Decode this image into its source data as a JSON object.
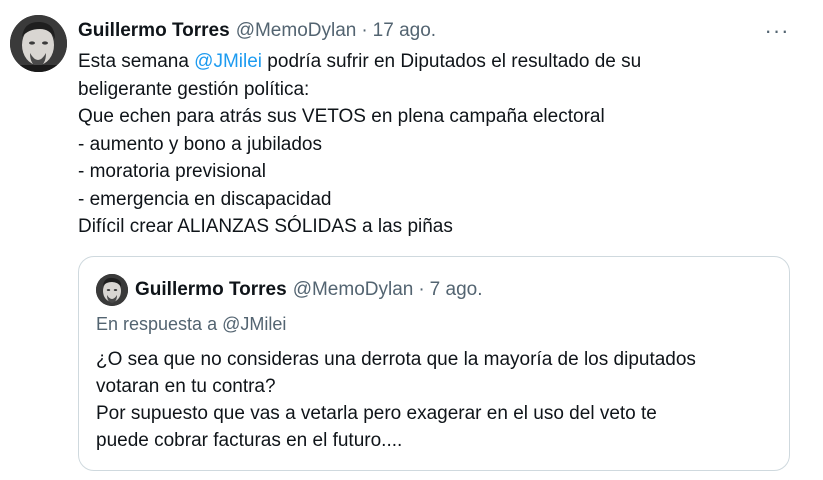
{
  "tweet": {
    "author_name": "Guillermo Torres",
    "author_handle": "@MemoDylan",
    "separator": "·",
    "time": "17 ago.",
    "more_icon": "more-horizontal-icon",
    "more_label": "···",
    "body": {
      "line1_pre": "Esta semana ",
      "line1_mention": "@JMilei",
      "line1_post": " podría sufrir en Diputados el resultado de su",
      "line2": "beligerante gestión política:",
      "line3": "Que echen para atrás sus VETOS en plena campaña electoral",
      "line4": "- aumento y bono a jubilados",
      "line5": "- moratoria previsional",
      "line6": "- emergencia en discapacidad",
      "line7": "Difícil crear ALIANZAS SÓLIDAS a las piñas"
    }
  },
  "quote": {
    "author_name": "Guillermo Torres",
    "author_handle": "@MemoDylan",
    "separator": "·",
    "time": "7 ago.",
    "reply_prefix": "En respuesta a ",
    "reply_mention": "@JMilei",
    "body": {
      "line1": "¿O sea que no consideras una derrota que la mayoría de los diputados",
      "line2": "votaran en tu contra?",
      "line3": "Por supuesto que vas a vetarla pero exagerar en el uso del veto te",
      "line4": "puede cobrar facturas en el futuro...."
    }
  },
  "colors": {
    "text": "#0f1419",
    "secondary": "#536471",
    "link": "#1d9bf0",
    "border": "#cfd9de"
  }
}
